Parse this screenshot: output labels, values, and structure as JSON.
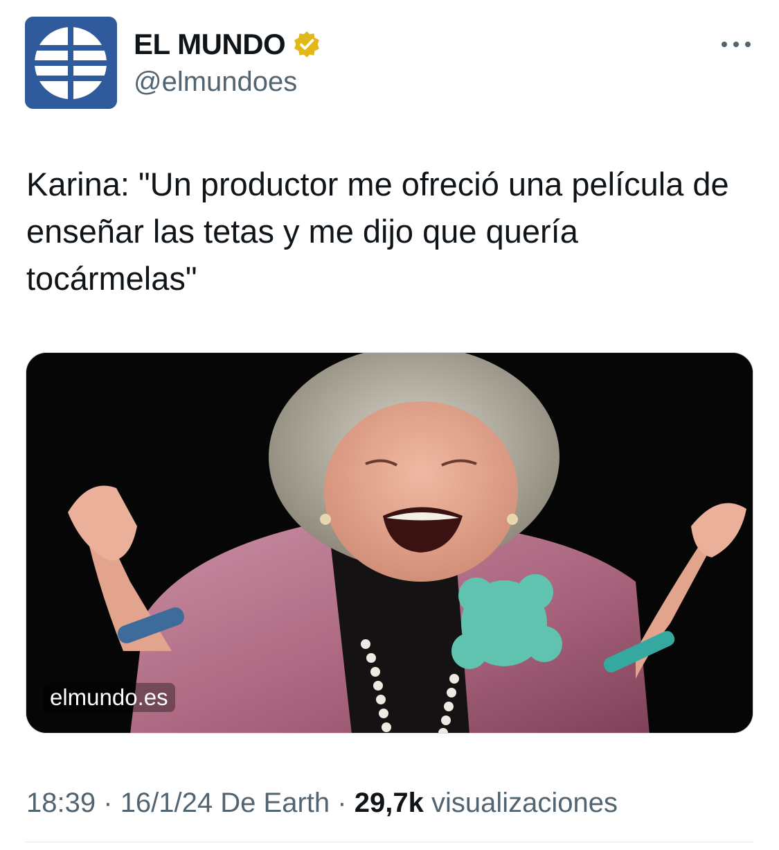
{
  "tweet": {
    "author": {
      "display_name": "EL MUNDO",
      "handle": "@elmundoes",
      "verified": true,
      "avatar_icon": "el-mundo-globe-logo",
      "avatar_color": "#2f5b9c",
      "verified_color": "#e2b719"
    },
    "text": "Karina: \"Un productor me ofreció una película de enseñar las tetas y me dijo que quería tocármelas\"",
    "media": {
      "source_label": "elmundo.es"
    },
    "meta": {
      "time": "18:39",
      "separator": "·",
      "date": "16/1/24",
      "via": "De Earth",
      "views_count": "29,7k",
      "views_label": "visualizaciones"
    },
    "more_icon": "more-dots-icon"
  }
}
